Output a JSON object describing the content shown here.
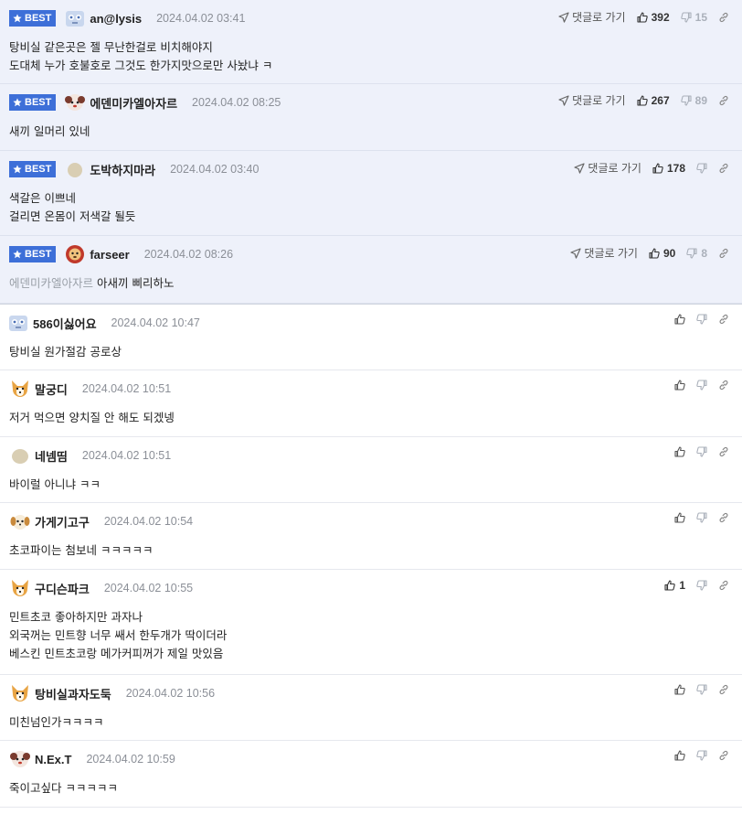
{
  "labels": {
    "best": "BEST",
    "reply": "댓글로 가기"
  },
  "comments": [
    {
      "best": true,
      "nick": "an@lysis",
      "date": "2024.04.02 03:41",
      "up": "392",
      "down": "15",
      "avatar": "robot-dog",
      "lines": [
        "탕비실 같은곳은 젤 무난한걸로 비치해야지",
        "도대체 누가 호불호로 그것도 한가지맛으로만 사놨냐 ㅋ"
      ]
    },
    {
      "best": true,
      "nick": "에덴미카엘아자르",
      "date": "2024.04.02 08:25",
      "up": "267",
      "down": "89",
      "avatar": "poodle",
      "lines": [
        "새끼 일머리 있네"
      ]
    },
    {
      "best": true,
      "nick": "도박하지마라",
      "date": "2024.04.02 03:40",
      "up": "178",
      "down": "",
      "avatar": "blob",
      "lines": [
        "색갈은 이쁘네",
        "걸리면 온몸이 저색갈 될듯"
      ]
    },
    {
      "best": true,
      "nick": "farseer",
      "date": "2024.04.02 08:26",
      "up": "90",
      "down": "8",
      "avatar": "lion",
      "mention": "에덴미카엘아자르",
      "lines": [
        "아새끼 삐리하노"
      ]
    },
    {
      "best": false,
      "nick": "586이싫어요",
      "date": "2024.04.02 10:47",
      "up": "",
      "avatar": "robot-dog",
      "lines": [
        "탕비실 원가절감 공로상"
      ]
    },
    {
      "best": false,
      "nick": "말궁디",
      "date": "2024.04.02 10:51",
      "up": "",
      "avatar": "corgi",
      "lines": [
        "저거 먹으면 양치질 안 해도 되겠넹"
      ]
    },
    {
      "best": false,
      "nick": "네넴띰",
      "date": "2024.04.02 10:51",
      "up": "",
      "avatar": "blob",
      "lines": [
        "바이럴 아니냐 ㅋㅋ"
      ]
    },
    {
      "best": false,
      "nick": "가게기고구",
      "date": "2024.04.02 10:54",
      "up": "",
      "avatar": "puppy",
      "lines": [
        "초코파이는 첨보네 ㅋㅋㅋㅋㅋ"
      ]
    },
    {
      "best": false,
      "nick": "구디슨파크",
      "date": "2024.04.02 10:55",
      "up": "1",
      "avatar": "corgi",
      "lines": [
        "민트초코 좋아하지만 과자나",
        "외국꺼는 민트향 너무 쌔서 한두개가 딱이더라",
        "베스킨 민트초코랑 메가커피꺼가 제일 맛있음"
      ]
    },
    {
      "best": false,
      "nick": "탕비실과자도둑",
      "date": "2024.04.02 10:56",
      "up": "",
      "avatar": "corgi",
      "lines": [
        "미친넘인가ㅋㅋㅋㅋ"
      ]
    },
    {
      "best": false,
      "nick": "N.Ex.T",
      "date": "2024.04.02 10:59",
      "up": "",
      "avatar": "poodle",
      "lines": [
        "죽이고싶다 ㅋㅋㅋㅋㅋ"
      ]
    }
  ]
}
